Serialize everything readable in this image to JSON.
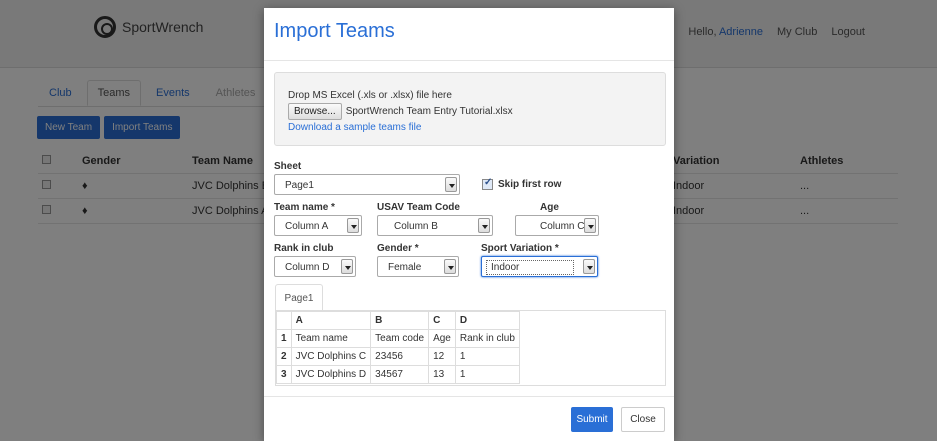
{
  "app": {
    "logo_text": "SportWrench",
    "greeting": "Hello,",
    "user": "Adrienne",
    "my_club": "My Club",
    "logout": "Logout"
  },
  "tabs": [
    {
      "label": "Club"
    },
    {
      "label": "Teams"
    },
    {
      "label": "Events"
    },
    {
      "label": "Athletes"
    }
  ],
  "actions": {
    "new_team": "New Team",
    "import_teams": "Import Teams"
  },
  "bg_table": {
    "headers": [
      "Gender",
      "Team Name",
      "Variation",
      "Athletes"
    ],
    "rows": [
      {
        "gender_icon": "female-icon",
        "name": "JVC Dolphins B",
        "variation": "Indoor",
        "athletes": "..."
      },
      {
        "gender_icon": "female-icon",
        "name": "JVC Dolphins A",
        "variation": "Indoor",
        "athletes": "..."
      }
    ]
  },
  "modal": {
    "title": "Import Teams",
    "drop_text": "Drop MS Excel (.xls or .xlsx) file here",
    "browse_label": "Browse...",
    "file_name": "SportWrench Team Entry Tutorial.xlsx",
    "sample_link": "Download a sample teams file",
    "sheet_label": "Sheet",
    "sheet_value": "Page1",
    "skip_first_row": "Skip first row",
    "skip_checked": true,
    "team_name_label": "Team name *",
    "team_name_value": "Column A",
    "usav_label": "USAV Team Code",
    "usav_value": "Column B",
    "age_label": "Age",
    "age_value": "Column C",
    "rank_label": "Rank in club",
    "rank_value": "Column D",
    "gender_label": "Gender *",
    "gender_value": "Female",
    "sport_label": "Sport Variation *",
    "sport_value": "Indoor",
    "sheet_tab": "Page1",
    "preview": {
      "columns": [
        "A",
        "B",
        "C",
        "D"
      ],
      "rows": [
        {
          "n": "1",
          "cells": [
            "Team name",
            "Team code",
            "Age",
            "Rank in club"
          ]
        },
        {
          "n": "2",
          "cells": [
            "JVC Dolphins C",
            "23456",
            "12",
            "1"
          ]
        },
        {
          "n": "3",
          "cells": [
            "JVC Dolphins D",
            "34567",
            "13",
            "1"
          ]
        }
      ]
    },
    "submit": "Submit",
    "close": "Close"
  },
  "colors": {
    "accent": "#2a6fd6",
    "overlay": "#000000"
  }
}
